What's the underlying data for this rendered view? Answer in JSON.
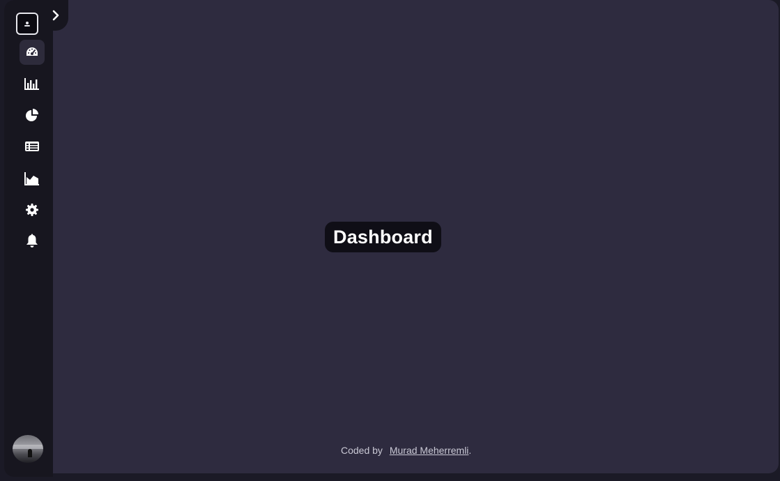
{
  "main": {
    "title": "Dashboard"
  },
  "sidebar": {
    "items": [
      {
        "id": "dashboard",
        "icon": "gauge-icon",
        "active": true
      },
      {
        "id": "bar-chart",
        "icon": "bar-chart-icon",
        "active": false
      },
      {
        "id": "pie-chart",
        "icon": "pie-chart-icon",
        "active": false
      },
      {
        "id": "table",
        "icon": "table-icon",
        "active": false
      },
      {
        "id": "area-chart",
        "icon": "area-chart-icon",
        "active": false
      },
      {
        "id": "settings",
        "icon": "gear-icon",
        "active": false
      },
      {
        "id": "notifications",
        "icon": "bell-icon",
        "active": false
      }
    ]
  },
  "footer": {
    "prefix": "Coded by",
    "author": "Murad Meherremli",
    "suffix": "."
  },
  "colors": {
    "background": "#1b1a26",
    "main_panel": "#2e2b3f",
    "sidebar": "#17161f",
    "active_item": "#2d2b3b",
    "text": "#ffffff"
  }
}
